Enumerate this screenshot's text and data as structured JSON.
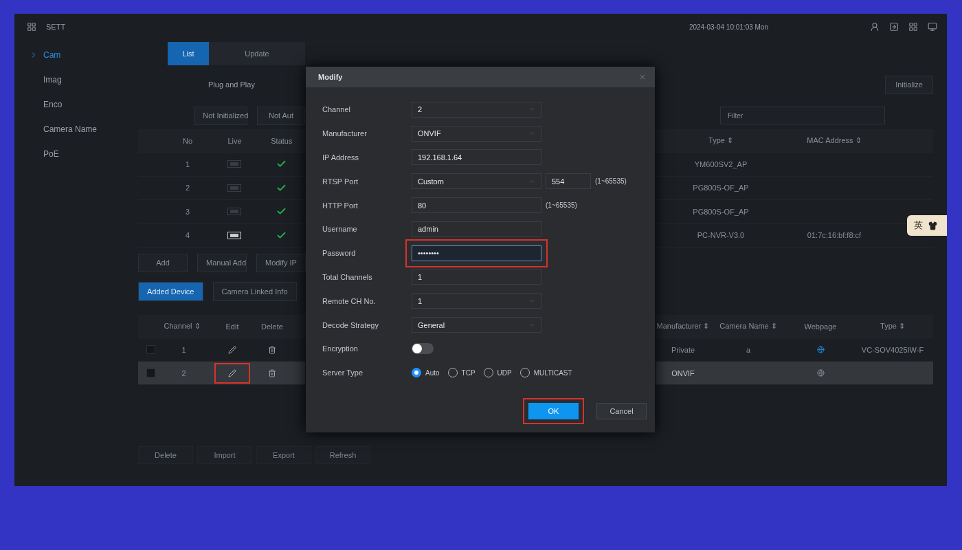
{
  "header": {
    "title": "SETT",
    "datetime": "2024-03-04 10:01:03 Mon"
  },
  "sidebar": {
    "items": [
      {
        "label": "Cam",
        "selected": true
      },
      {
        "label": "Imag",
        "selected": false
      },
      {
        "label": "Enco",
        "selected": false
      },
      {
        "label": "Camera Name",
        "selected": false
      },
      {
        "label": "PoE",
        "selected": false
      }
    ]
  },
  "tabs": [
    {
      "label": "List",
      "selected": true
    },
    {
      "label": "Update",
      "selected": false
    }
  ],
  "mode": "Plug and Play",
  "initialize_button": "Initialize",
  "filters": [
    {
      "label": "Not Initialized",
      "selected": false
    },
    {
      "label": "Not Aut",
      "selected": false
    }
  ],
  "filter_field": {
    "placeholder": "Filter"
  },
  "device_table": {
    "left_columns": [
      "No",
      "Live",
      "Status"
    ],
    "right_columns": [
      "Type ⇕",
      "MAC Address ⇕"
    ],
    "rows": [
      {
        "no": "1",
        "live_active": false,
        "online": true,
        "type": "YM600SV2_AP"
      },
      {
        "no": "2",
        "live_active": false,
        "online": true,
        "type": "PG800S-OF_AP"
      },
      {
        "no": "3",
        "live_active": false,
        "online": true,
        "type": "PG800S-OF_AP"
      },
      {
        "no": "4",
        "live_active": true,
        "online": true,
        "type": "PC-NVR-V3.0",
        "mac": "01:7c:16:bf:f8:cf"
      }
    ]
  },
  "actions": [
    "Add",
    "Manual Add",
    "Modify IP"
  ],
  "subtabs": [
    {
      "label": "Added Device",
      "selected": true
    },
    {
      "label": "Camera Linked Info",
      "selected": false
    }
  ],
  "added_table": {
    "left_columns": [
      "Channel ⇕",
      "Edit",
      "Delete"
    ],
    "right_columns": [
      "Manufacturer ⇕",
      "Camera Name ⇕",
      "Webpage",
      "Type ⇕"
    ],
    "rows": [
      {
        "channel": "1",
        "selected": false,
        "checked": false,
        "edit_highlighted": false,
        "manufacturer": "Private",
        "camera_name": "a",
        "webpage_active": true,
        "type": "VC-SOV4025IW-F"
      },
      {
        "channel": "2",
        "selected": true,
        "checked": false,
        "edit_highlighted": true,
        "manufacturer": "ONVIF",
        "webpage_active": false
      }
    ]
  },
  "footer_buttons": [
    "Delete",
    "Import",
    "Export",
    "Refresh"
  ],
  "ime": {
    "label": "英"
  },
  "dialog": {
    "title": "Modify",
    "fields": [
      {
        "kind": "select",
        "label": "Channel",
        "value": "2"
      },
      {
        "kind": "select",
        "label": "Manufacturer",
        "value": "ONVIF"
      },
      {
        "kind": "text",
        "label": "IP Address",
        "value": "192.168.1.64"
      },
      {
        "kind": "port",
        "label": "RTSP Port",
        "value": "Custom",
        "port": "554",
        "range": "(1~65535)"
      },
      {
        "kind": "text",
        "label": "HTTP Port",
        "value": "80",
        "range": "(1~65535)"
      },
      {
        "kind": "text",
        "label": "Username",
        "value": "admin"
      },
      {
        "kind": "password",
        "label": "Password",
        "value": "••••••••",
        "highlighted": true
      },
      {
        "kind": "text",
        "label": "Total Channels",
        "value": "1"
      },
      {
        "kind": "select",
        "label": "Remote CH No.",
        "value": "1"
      },
      {
        "kind": "select",
        "label": "Decode Strategy",
        "value": "General"
      },
      {
        "kind": "toggle",
        "label": "Encryption",
        "on": false
      },
      {
        "kind": "radio",
        "label": "Server Type",
        "options": [
          {
            "label": "Auto",
            "selected": true
          },
          {
            "label": "TCP",
            "selected": false
          },
          {
            "label": "UDP",
            "selected": false
          },
          {
            "label": "MULTICAST",
            "selected": false
          }
        ]
      }
    ],
    "ok": {
      "label": "OK",
      "highlighted": true
    },
    "cancel": "Cancel"
  }
}
